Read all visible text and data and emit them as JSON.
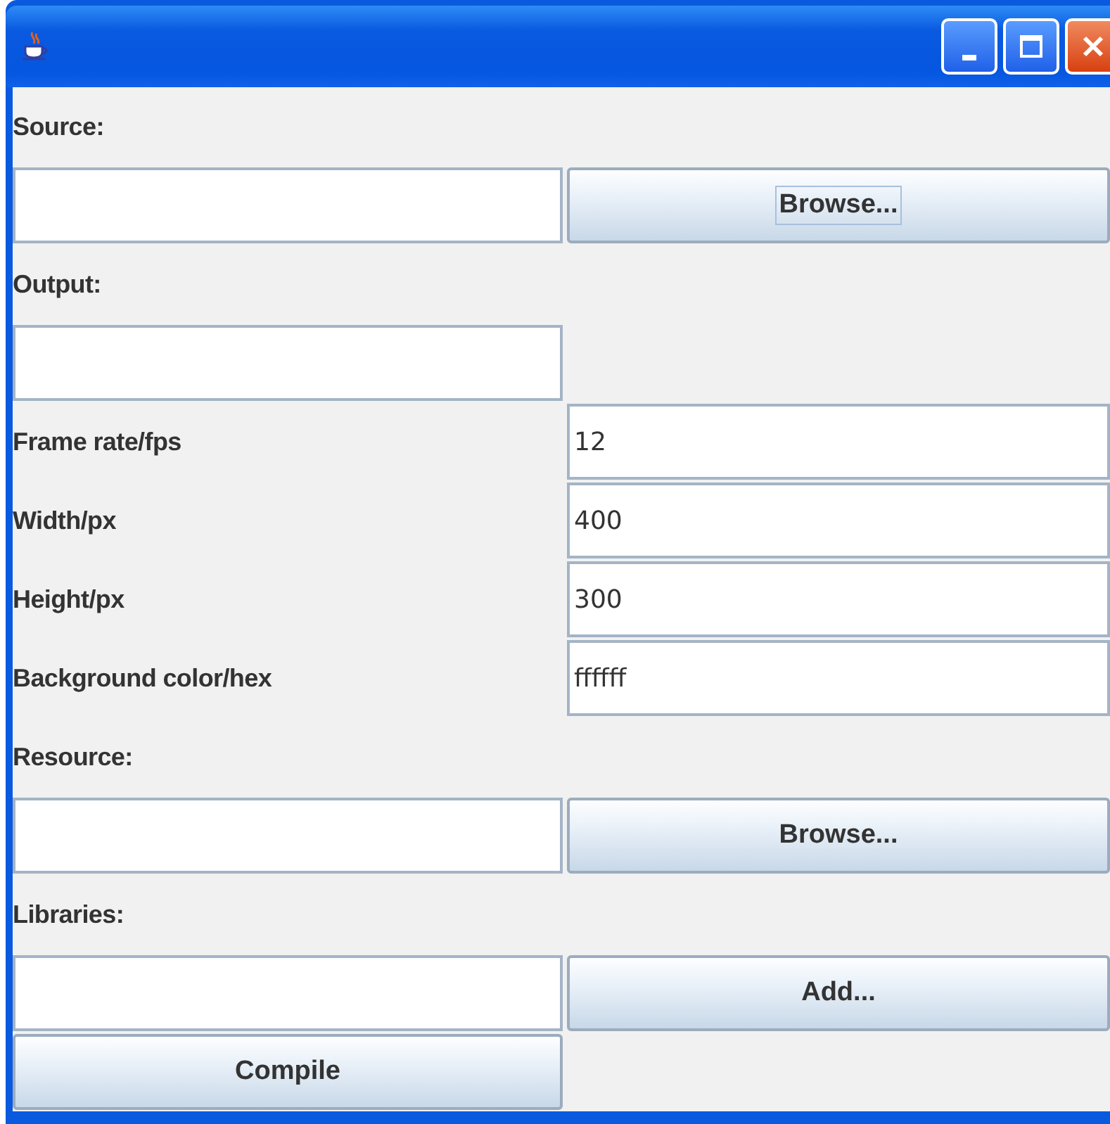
{
  "rows": [
    {
      "cells": [
        {
          "kind": "label",
          "text": "Source:"
        }
      ]
    },
    {
      "cells": [
        {
          "kind": "field"
        },
        {
          "kind": "button",
          "label": "Browse...",
          "focused": true
        }
      ]
    },
    {
      "cells": [
        {
          "kind": "label",
          "text": "Output:"
        }
      ]
    },
    {
      "cells": [
        {
          "kind": "field"
        }
      ]
    },
    {
      "cells": [
        {
          "kind": "label",
          "text": "Frame rate/fps"
        },
        {
          "kind": "field",
          "value": "12"
        }
      ]
    },
    {
      "cells": [
        {
          "kind": "label",
          "text": "Width/px"
        },
        {
          "kind": "field",
          "value": "400"
        }
      ]
    },
    {
      "cells": [
        {
          "kind": "label",
          "text": "Height/px"
        },
        {
          "kind": "field",
          "value": "300"
        }
      ]
    },
    {
      "cells": [
        {
          "kind": "label",
          "text": "Background color/hex"
        },
        {
          "kind": "field",
          "value": "ffffff"
        }
      ]
    },
    {
      "cells": [
        {
          "kind": "label",
          "text": "Resource:"
        }
      ]
    },
    {
      "cells": [
        {
          "kind": "field"
        },
        {
          "kind": "button",
          "label": "Browse...",
          "focused": false
        }
      ]
    },
    {
      "cells": [
        {
          "kind": "label",
          "text": "Libraries:"
        }
      ]
    },
    {
      "cells": [
        {
          "kind": "field"
        },
        {
          "kind": "button",
          "label": "Add...",
          "focused": false
        }
      ]
    },
    {
      "cells": [
        {
          "kind": "button",
          "label": "Compile",
          "focused": false
        }
      ]
    }
  ]
}
